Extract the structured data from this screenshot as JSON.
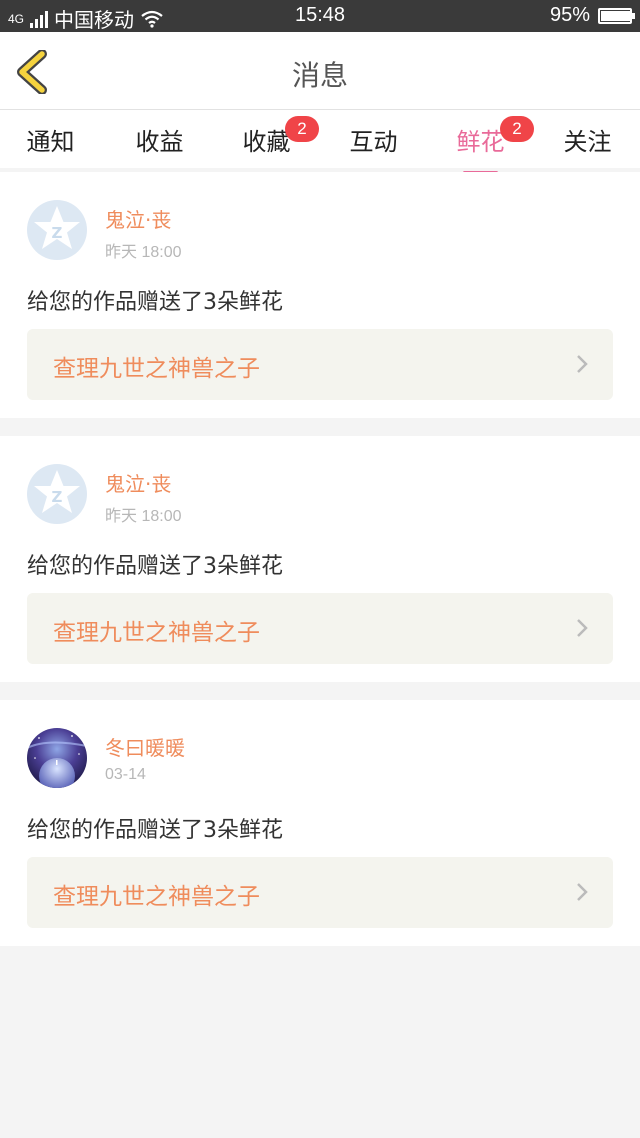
{
  "status_bar": {
    "network_tag": "4G",
    "carrier": "中国移动",
    "time": "15:48",
    "battery": "95%",
    "battery_level": 0.95
  },
  "header": {
    "title": "消息"
  },
  "tabs": [
    {
      "label": "通知",
      "badge": ""
    },
    {
      "label": "收益",
      "badge": ""
    },
    {
      "label": "收藏",
      "badge": "2"
    },
    {
      "label": "互动",
      "badge": ""
    },
    {
      "label": "鲜花",
      "badge": "2",
      "active": true
    },
    {
      "label": "关注",
      "badge": ""
    }
  ],
  "colors": {
    "accent_pink": "#e96a99",
    "username_orange": "#ef8c5c",
    "badge_red": "#f04448",
    "back_arrow_yellow": "#f5d33e"
  },
  "messages": [
    {
      "user": "鬼泣·丧",
      "time": "昨天 18:00",
      "avatar": "qq-default-avatar",
      "text": "给您的作品赠送了3朵鲜花",
      "work_title": "查理九世之神兽之子"
    },
    {
      "user": "鬼泣·丧",
      "time": "昨天 18:00",
      "avatar": "qq-default-avatar",
      "text": "给您的作品赠送了3朵鲜花",
      "work_title": "查理九世之神兽之子"
    },
    {
      "user": "冬曰暖暖",
      "time": "03-14",
      "avatar": "galaxy-photo-avatar",
      "text": "给您的作品赠送了3朵鲜花",
      "work_title": "查理九世之神兽之子"
    }
  ]
}
